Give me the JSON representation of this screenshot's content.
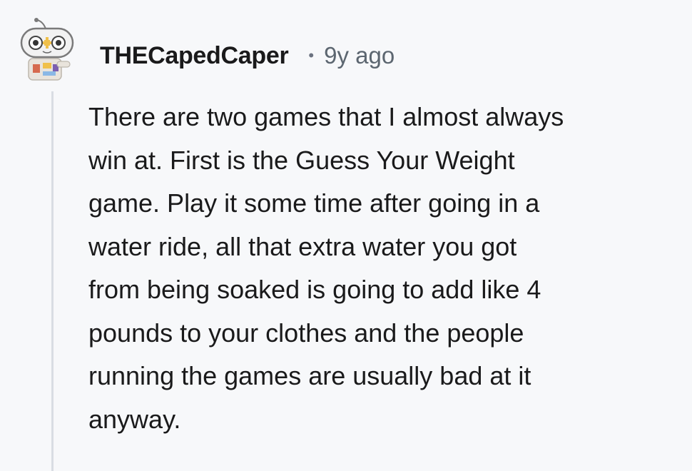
{
  "comment": {
    "author": "THECapedCaper",
    "separator": "•",
    "age": "9y ago",
    "avatar_icon": "snoo-gamepad-avatar-icon",
    "body_lines": [
      "There are two games that I almost always",
      "win at. First is the Guess Your Weight",
      "game. Play it some time after going in a",
      "water ride, all that extra water you got",
      "from being soaked is going to add like 4",
      "pounds to your clothes and the people",
      "running the games are usually bad at it",
      "anyway."
    ]
  },
  "colors": {
    "background": "#f7f8fa",
    "text": "#1a1a1b",
    "meta": "#5c6670",
    "thread_line": "#d9dde3"
  }
}
